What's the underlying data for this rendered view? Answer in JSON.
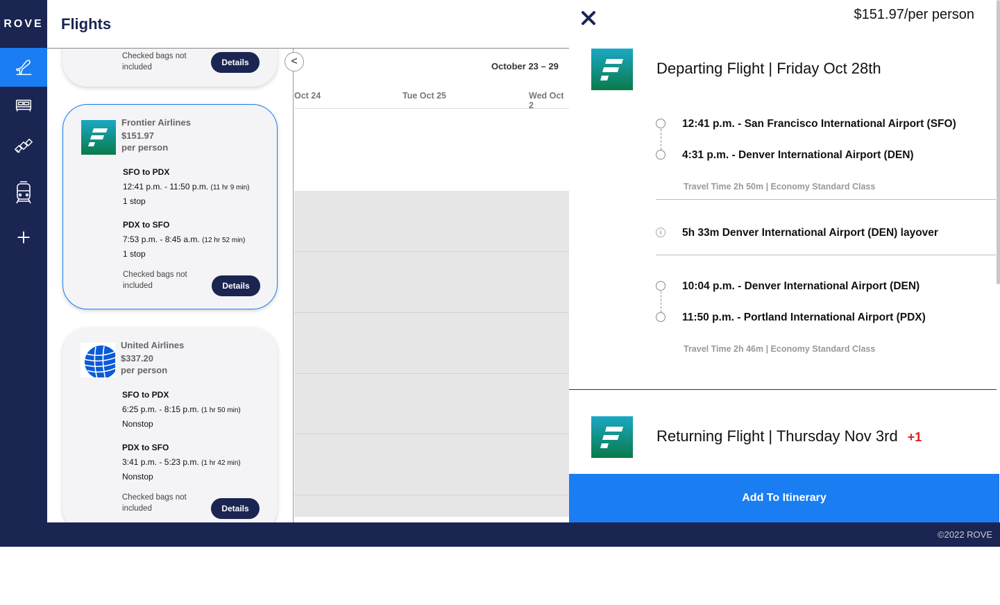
{
  "brand": {
    "logo_text": "ROVE"
  },
  "nav": {
    "items": [
      {
        "icon": "plane-icon",
        "active": true
      },
      {
        "icon": "bed-icon",
        "active": false
      },
      {
        "icon": "satellite-icon",
        "active": false
      },
      {
        "icon": "train-icon",
        "active": false
      },
      {
        "icon": "plus-icon",
        "active": false
      }
    ]
  },
  "header": {
    "title": "Flights"
  },
  "results": {
    "cards": [
      {
        "airline": "",
        "price": "",
        "per_person": "",
        "segments": [],
        "bags": [
          "Checked bags not",
          "included"
        ],
        "details_label": "Details"
      },
      {
        "airline": "Frontier Airlines",
        "price": "$151.97",
        "per_person": "per person",
        "segments": [
          {
            "route": "SFO to PDX",
            "time": "12:41 p.m. - 11:50 p.m.",
            "duration": "(11 hr 9 min)",
            "stops": "1 stop"
          },
          {
            "route": "PDX to SFO",
            "time": "7:53 p.m. - 8:45 a.m.",
            "duration": "(12 hr 52 min)",
            "stops": "1 stop"
          }
        ],
        "bags": [
          "Checked bags not",
          "included"
        ],
        "details_label": "Details"
      },
      {
        "airline": "United Airlines",
        "price": "$337.20",
        "per_person": "per person",
        "segments": [
          {
            "route": "SFO to PDX",
            "time": "6:25 p.m. - 8:15 p.m.",
            "duration": "(1 hr 50 min)",
            "stops": "Nonstop"
          },
          {
            "route": "PDX to SFO",
            "time": "3:41 p.m. - 5:23 p.m.",
            "duration": "(1 hr 42 min)",
            "stops": "Nonstop"
          }
        ],
        "bags": [
          "Checked bags not",
          "included"
        ],
        "details_label": "Details"
      }
    ],
    "collapse_label": "<"
  },
  "calendar": {
    "week_range": "October 23 – 29",
    "days": [
      "Oct 24",
      "Tue Oct 25",
      "Wed Oct 2"
    ]
  },
  "detail": {
    "price_label": "$151.97/per person",
    "departing": {
      "heading": "Departing Flight | Friday Oct 28th",
      "leg1_from": "12:41 p.m. - San Francisco International Airport (SFO)",
      "leg1_to": "4:31 p.m. - Denver International Airport (DEN)",
      "leg1_travel": "Travel Time 2h 50m | Economy Standard Class",
      "layover": "5h 33m Denver International Airport (DEN) layover",
      "leg2_from": "10:04 p.m. - Denver International Airport (DEN)",
      "leg2_to": "11:50 p.m. - Portland International Airport (PDX)",
      "leg2_travel": "Travel Time 2h 46m | Economy Standard Class"
    },
    "returning": {
      "heading": "Returning Flight | Thursday Nov 3rd",
      "day_offset": "+1"
    },
    "add_button": "Add To Itinerary"
  },
  "footer": {
    "copyright": "©2022 ROVE"
  },
  "colors": {
    "navy": "#1a2552",
    "accent_blue": "#1a7df2",
    "alert_red": "#e02020"
  }
}
